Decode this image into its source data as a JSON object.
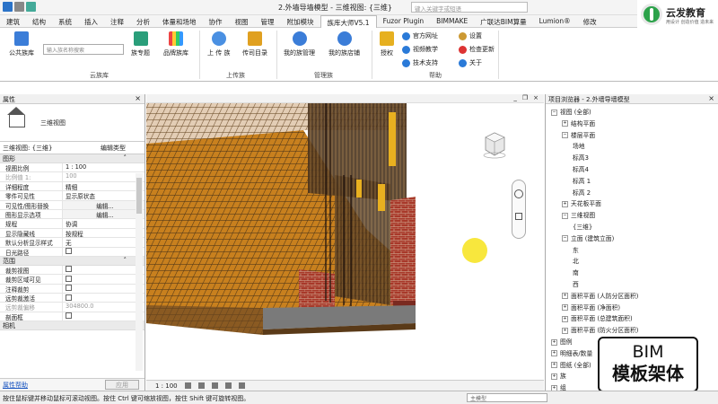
{
  "window": {
    "title": "2.外墙导墙模型 - 三维视图: {三维}",
    "search_placeholder": "键入关键字或短语"
  },
  "logo": {
    "name": "云发教育",
    "slogan": "用设计  创造价值  造未来"
  },
  "tabs": [
    "建筑",
    "结构",
    "系统",
    "插入",
    "注释",
    "分析",
    "体量和场地",
    "协作",
    "视图",
    "管理",
    "附加模块",
    "族库大师V5.1",
    "Fuzor Plugin",
    "BIMMAKE",
    "广联达BIM算量",
    "Lumion®",
    "修改"
  ],
  "active_tab": "族库大师V5.1",
  "ribbon": {
    "search_placeholder": "输入族名称搜索",
    "public": "公共族库",
    "mine": "族专题",
    "brand": "品牌族库",
    "upload": "上 传 族",
    "fetch": "传司目录",
    "mymanage": "我的族管理",
    "mystore": "我的族店铺",
    "auth": "授权",
    "site": "官方网址",
    "video": "视频教学",
    "support": "技术支持",
    "settings": "设置",
    "update": "检查更新",
    "about": "关于",
    "panels": {
      "cloud": "云族库",
      "upload": "上传族",
      "manage": "管理族",
      "help": "帮助"
    }
  },
  "properties": {
    "title": "属性",
    "type_name": "三维视图",
    "instance": "三维视图: {三维}",
    "edit_type": "编辑类型",
    "group1": "图形",
    "group2": "范围",
    "group3": "相机",
    "rows1": [
      {
        "name": "视图比例",
        "value": "1 : 100"
      },
      {
        "name": "比例值 1:",
        "value": "100"
      },
      {
        "name": "详细程度",
        "value": "精细"
      },
      {
        "name": "零件可见性",
        "value": "显示原状态"
      },
      {
        "name": "可见性/图形替换",
        "value": "编辑..."
      },
      {
        "name": "图形显示选项",
        "value": "编辑..."
      },
      {
        "name": "规程",
        "value": "协调"
      },
      {
        "name": "显示隐藏线",
        "value": "按规程"
      },
      {
        "name": "默认分析显示样式",
        "value": "无"
      },
      {
        "name": "日光路径",
        "value": ""
      }
    ],
    "rows2": [
      {
        "name": "裁剪视图",
        "value": ""
      },
      {
        "name": "裁剪区域可见",
        "value": ""
      },
      {
        "name": "注释裁剪",
        "value": ""
      },
      {
        "name": "远剪裁激活",
        "value": ""
      },
      {
        "name": "远剪裁偏移",
        "value": "304800.0"
      },
      {
        "name": "剖面框",
        "value": ""
      }
    ],
    "help": "属性帮助",
    "apply": "应用"
  },
  "viewport": {
    "scale": "1 : 100"
  },
  "browser": {
    "title": "项目浏览器 - 2.外墙导墙模型",
    "nodes": [
      "视图 (全部)",
      "结构平面",
      "楼层平面",
      "场地",
      "标高3",
      "标高4",
      "标高 1",
      "标高 2",
      "天花板平面",
      "三维视图",
      "{三维}",
      "立面 (建筑立面)",
      "东",
      "北",
      "南",
      "西",
      "面积平面 (人防分区面积)",
      "面积平面 (净面积)",
      "面积平面 (总建筑面积)",
      "面积平面 (防火分区面积)",
      "图例",
      "明细表/数量",
      "图纸 (全部)",
      "族",
      "组"
    ]
  },
  "overlay": {
    "line1": "BIM",
    "line2": "模板架体"
  },
  "status": {
    "text": "按住鼠标键并移动鼠标可滚动视图。按住 Ctrl 键可缩放视图，按住 Shift 键可旋转视图。",
    "model": "主模型"
  }
}
